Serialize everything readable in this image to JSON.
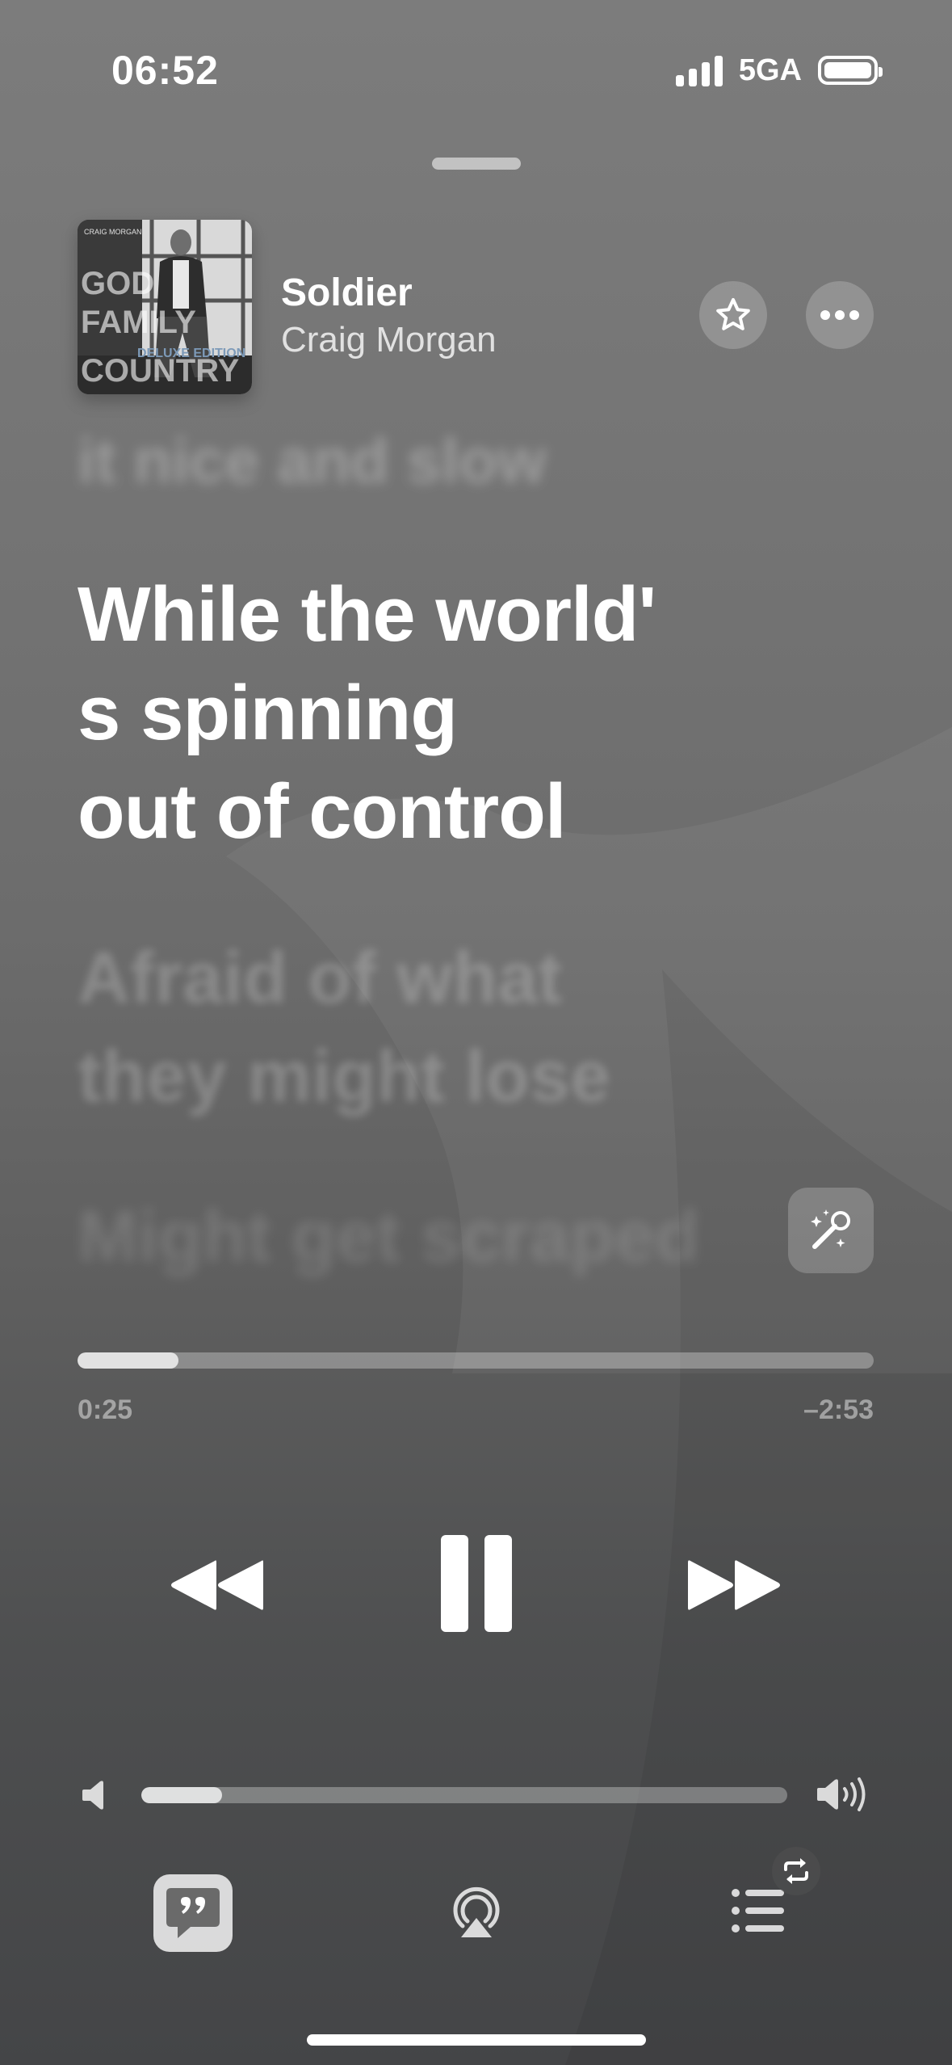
{
  "status_bar": {
    "time": "06:52",
    "network": "5GA",
    "signal_bars": 4,
    "battery_level": 1.0
  },
  "now_playing": {
    "title": "Soldier",
    "artist": "Craig Morgan",
    "album_art": {
      "top_text": "CRAIG MORGAN",
      "lines": [
        "GOD",
        "FAMILY",
        "COUNTRY"
      ],
      "edition": "DELUXE EDITION"
    },
    "favorite_icon": "star-icon",
    "more_icon": "ellipsis-icon"
  },
  "lyrics": {
    "previous": "it nice and slow",
    "current": "While the world'\ns spinning\nout of control",
    "next": "Afraid of what\nthey might lose",
    "next2": "Might get scraped"
  },
  "playback": {
    "elapsed": "0:25",
    "remaining": "–2:53",
    "progress": 0.127,
    "state": "playing"
  },
  "volume": {
    "level": 0.125
  },
  "bottom_bar": {
    "lyrics_icon": "lyrics-quote-icon",
    "airplay_icon": "airplay-icon",
    "queue_icon": "queue-list-icon",
    "repeat_icon": "repeat-icon"
  }
}
